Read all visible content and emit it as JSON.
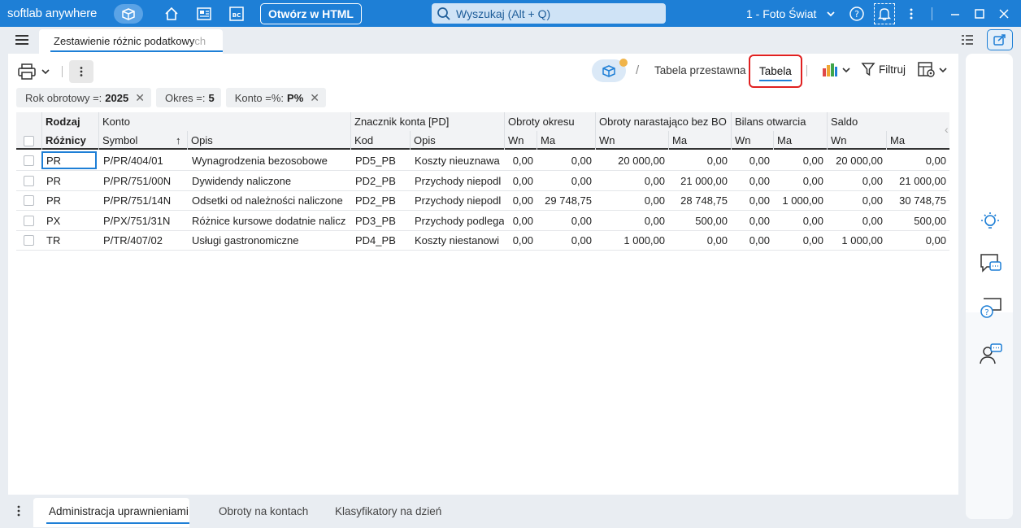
{
  "app": {
    "brand": "softlab anywhere",
    "open_html": "Otwórz w HTML",
    "search_placeholder": "Wyszukaj (Alt + Q)",
    "company": "1 - Foto Świat"
  },
  "document_tab": {
    "label": "Zestawienie różnic podatkowych",
    "label_visible": "Zestawienie różnic podatkowy",
    "label_fade": "ch"
  },
  "view_tabs": {
    "pivot": "Tabela przestawna",
    "table": "Tabela",
    "filter": "Filtruj"
  },
  "chips": [
    {
      "label": "Rok obrotowy =:",
      "value": "2025",
      "removable": true
    },
    {
      "label": "Okres =:",
      "value": "5",
      "removable": false
    },
    {
      "label": "Konto =%:",
      "value": "P%",
      "removable": true
    }
  ],
  "grid": {
    "groups": {
      "rodzaj": "Rodzaj",
      "konto": "Konto",
      "znacznik": "Znacznik konta  [PD]",
      "obroty_okresu": "Obroty okresu",
      "obroty_narast": "Obroty narastająco bez BO",
      "bilans": "Bilans otwarcia",
      "saldo": "Saldo"
    },
    "columns": {
      "roznicy": "Różnicy",
      "symbol": "Symbol",
      "sort_arrow": "↑",
      "opis": "Opis",
      "kod": "Kod",
      "opis2": "Opis",
      "wn1": "Wn",
      "ma1": "Ma",
      "wn2": "Wn",
      "ma2": "Ma",
      "wn3": "Wn",
      "ma3": "Ma",
      "wn4": "Wn",
      "ma4": "Ma"
    },
    "rows": [
      {
        "rodzaj": "PR",
        "symbol": "P/PR/404/01",
        "opis": "Wynagrodzenia bezosobowe",
        "kod": "PD5_PB",
        "opis2": "Koszty nieuznawa",
        "oo_wn": "0,00",
        "oo_ma": "0,00",
        "on_wn": "20 000,00",
        "on_ma": "0,00",
        "bo_wn": "0,00",
        "bo_ma": "0,00",
        "s_wn": "20 000,00",
        "s_ma": "0,00"
      },
      {
        "rodzaj": "PR",
        "symbol": "P/PR/751/00N",
        "opis": "Dywidendy naliczone",
        "kod": "PD2_PB",
        "opis2": "Przychody niepodl",
        "oo_wn": "0,00",
        "oo_ma": "0,00",
        "on_wn": "0,00",
        "on_ma": "21 000,00",
        "bo_wn": "0,00",
        "bo_ma": "0,00",
        "s_wn": "0,00",
        "s_ma": "21 000,00"
      },
      {
        "rodzaj": "PR",
        "symbol": "P/PR/751/14N",
        "opis": "Odsetki od należności naliczone",
        "kod": "PD2_PB",
        "opis2": "Przychody niepodl",
        "oo_wn": "0,00",
        "oo_ma": "29 748,75",
        "on_wn": "0,00",
        "on_ma": "28 748,75",
        "bo_wn": "0,00",
        "bo_ma": "1 000,00",
        "s_wn": "0,00",
        "s_ma": "30 748,75"
      },
      {
        "rodzaj": "PX",
        "symbol": "P/PX/751/31N",
        "opis": "Różnice kursowe dodatnie nalicz",
        "kod": "PD3_PB",
        "opis2": "Przychody podlega",
        "oo_wn": "0,00",
        "oo_ma": "0,00",
        "on_wn": "0,00",
        "on_ma": "500,00",
        "bo_wn": "0,00",
        "bo_ma": "0,00",
        "s_wn": "0,00",
        "s_ma": "500,00"
      },
      {
        "rodzaj": "TR",
        "symbol": "P/TR/407/02",
        "opis": "Usługi gastronomiczne",
        "kod": "PD4_PB",
        "opis2": "Koszty niestanowi",
        "oo_wn": "0,00",
        "oo_ma": "0,00",
        "on_wn": "1 000,00",
        "on_ma": "0,00",
        "bo_wn": "0,00",
        "bo_ma": "0,00",
        "s_wn": "1 000,00",
        "s_ma": "0,00"
      }
    ]
  },
  "bottom_tabs": [
    {
      "label": "Administracja uprawnieniami",
      "active": true
    },
    {
      "label": "Obroty na kontach",
      "active": false
    },
    {
      "label": "Klasyfikatory na dzień",
      "active": false
    }
  ],
  "icons": {
    "brand_cube": "cube-icon",
    "home": "home-icon",
    "news": "newspaper-icon",
    "bc": "bc-icon",
    "help": "help-circle-icon",
    "bell": "bell-icon",
    "print": "printer-icon",
    "chart": "bar-chart-icon",
    "filter": "filter-icon",
    "settings": "table-settings-icon",
    "idea": "lightbulb-icon",
    "chat": "chat-icon",
    "question_chat": "question-chat-icon",
    "support": "support-agent-icon"
  },
  "colors": {
    "accent": "#1e7fd6",
    "highlight_border": "#e02020",
    "badge": "#f0b44a"
  }
}
